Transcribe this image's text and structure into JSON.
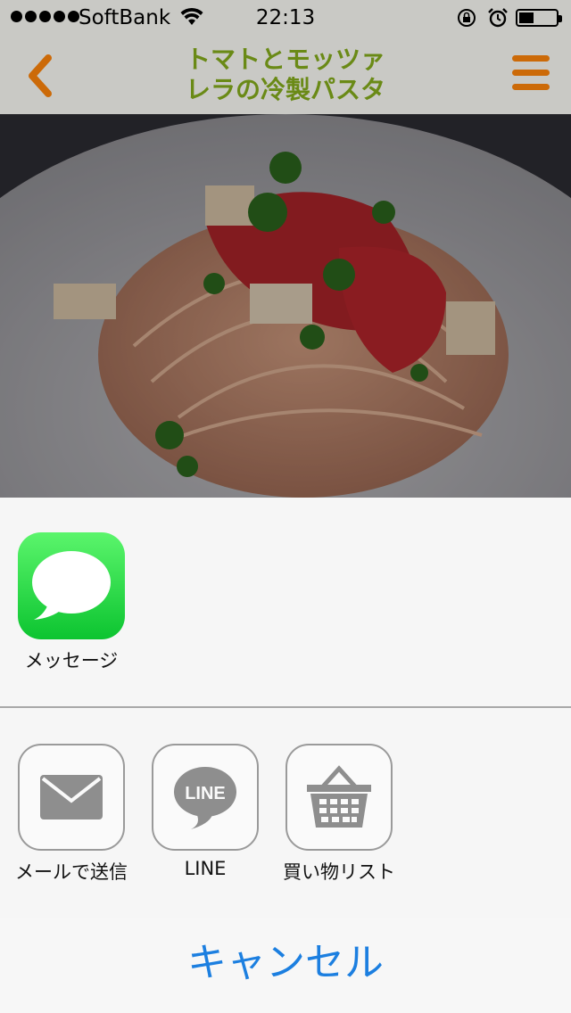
{
  "status_bar": {
    "carrier": "SoftBank",
    "time": "22:13",
    "signal_bars": 5,
    "battery_level": 0.4
  },
  "nav": {
    "title_line1": "トマトとモッツァ",
    "title_line2": "レラの冷製パスタ",
    "accent_color": "#cc6a08",
    "title_color": "#6a8a16"
  },
  "share_sheet": {
    "airdrop_apps": [
      {
        "label": "メッセージ",
        "icon": "message-bubble-icon"
      }
    ],
    "actions": [
      {
        "label": "メールで送信",
        "icon": "envelope-icon"
      },
      {
        "label": "LINE",
        "icon": "line-logo-icon"
      },
      {
        "label": "買い物リスト",
        "icon": "shopping-basket-icon"
      }
    ],
    "cancel_label": "キャンセル"
  },
  "photo": {
    "subject": "pasta-photo"
  }
}
